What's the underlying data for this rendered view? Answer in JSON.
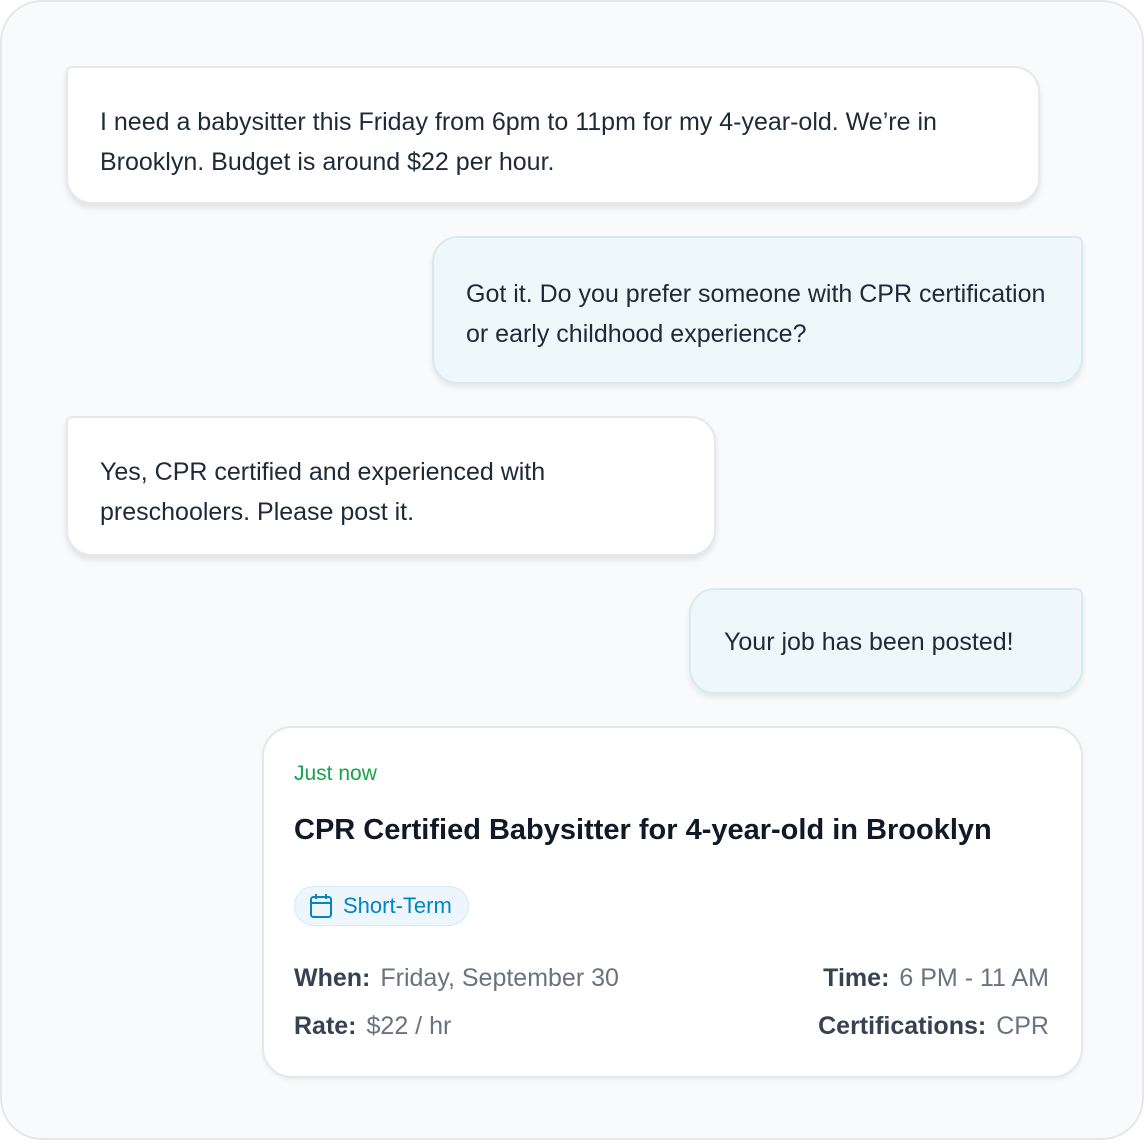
{
  "messages": [
    {
      "role": "user",
      "text": "I need a babysitter this Friday from 6pm to 11pm for my 4-year-old. We’re in Brooklyn. Budget is around $22 per hour."
    },
    {
      "role": "assistant",
      "text": "Got it. Do you prefer someone with CPR certification or early childhood experience?"
    },
    {
      "role": "user",
      "text": "Yes, CPR certified and experienced with preschoolers. Please post it."
    },
    {
      "role": "assistant",
      "text": "Your job has been posted!"
    }
  ],
  "job_card": {
    "posted": "Just now",
    "title": "CPR Certified Babysitter for 4-year-old in Brooklyn",
    "tag": {
      "label": "Short-Term",
      "icon": "calendar-icon"
    },
    "when_label": "When:",
    "when_value": "Friday, September 30",
    "time_label": "Time:",
    "time_value": "6 PM - 11 AM",
    "rate_label": "Rate:",
    "rate_value": "$22 / hr",
    "certs_label": "Certifications:",
    "certs_value": "CPR"
  },
  "colors": {
    "accent_green": "#16a34a",
    "tag_blue": "#0284c7",
    "bot_bubble": "#eef7f9",
    "user_bubble": "#ffffff"
  }
}
